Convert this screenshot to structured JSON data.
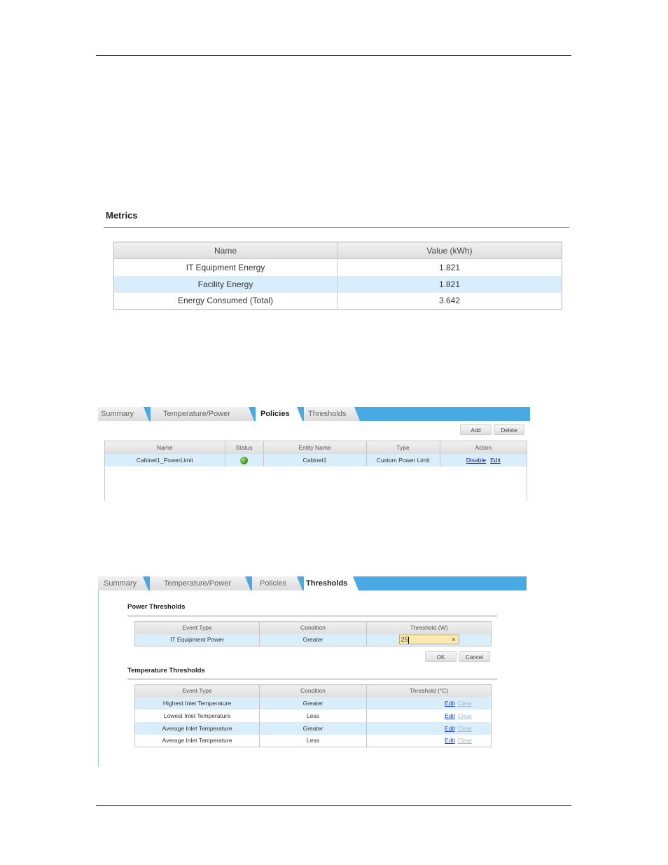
{
  "metrics": {
    "title": "Metrics",
    "headers": [
      "Name",
      "Value (kWh)"
    ],
    "rows": [
      {
        "name": "IT Equipment Energy",
        "value": "1.821"
      },
      {
        "name": "Facility Energy",
        "value": "1.821"
      },
      {
        "name": "Energy Consumed (Total)",
        "value": "3.642"
      }
    ]
  },
  "policies_view": {
    "tabs": [
      "Summary",
      "Temperature/Power",
      "Policies",
      "Thresholds"
    ],
    "active_tab": "Policies",
    "add_label": "Add",
    "delete_label": "Delete",
    "headers": [
      "Name",
      "Status",
      "Entity Name",
      "Type",
      "Action"
    ],
    "row": {
      "name": "Cabinet1_PowerLimit",
      "status": "green",
      "entity": "Cabinet1",
      "type": "Custom Power Limit",
      "disable_label": "Disable",
      "edit_label": "Edit"
    }
  },
  "thresholds_view": {
    "tabs": [
      "Summary",
      "Temperature/Power",
      "Policies",
      "Thresholds"
    ],
    "active_tab": "Thresholds",
    "power": {
      "title": "Power Thresholds",
      "headers": [
        "Event Type",
        "Condition",
        "Threshold (W)"
      ],
      "row": {
        "event": "IT Equipment Power",
        "condition": "Greater",
        "value": "25"
      },
      "clear_icon": "×",
      "ok_label": "OK",
      "cancel_label": "Cancel"
    },
    "temperature": {
      "title": "Temperature Thresholds",
      "headers": [
        "Event Type",
        "Condition",
        "Threshold (°C)"
      ],
      "edit_label": "Edit",
      "clear_label": "Clear",
      "rows": [
        {
          "event": "Highest Inlet Temperature",
          "condition": "Greater"
        },
        {
          "event": "Lowest Inlet Temperature",
          "condition": "Less"
        },
        {
          "event": "Average Inlet Temperature",
          "condition": "Greater"
        },
        {
          "event": "Average Inlet Temperature",
          "condition": "Less"
        }
      ]
    }
  },
  "colors": {
    "accent": "#4aa9e2",
    "row_highlight": "#d9edfa",
    "status_ok": "#3f9a1c"
  }
}
